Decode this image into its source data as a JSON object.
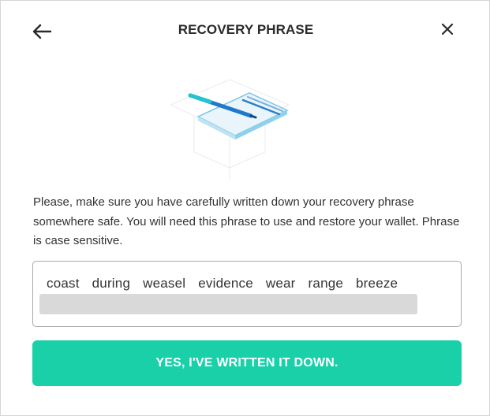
{
  "header": {
    "title": "RECOVERY PHRASE",
    "back_icon": "arrow-left-icon",
    "close_icon": "close-icon"
  },
  "illustration": {
    "icon": "notebook-with-pen-icon"
  },
  "description": "Please, make sure you have carefully written down your recovery phrase somewhere safe. You will need this phrase to use and restore your wallet. Phrase is case sensitive.",
  "phrase": {
    "visible_words": [
      "coast",
      "during",
      "weasel",
      "evidence",
      "wear",
      "range",
      "breeze"
    ],
    "remaining_hidden": true
  },
  "confirm_button": {
    "label": "YES, I'VE WRITTEN IT DOWN."
  },
  "colors": {
    "accent": "#19d0a9",
    "illustration_blue": "#2b7fc6"
  }
}
